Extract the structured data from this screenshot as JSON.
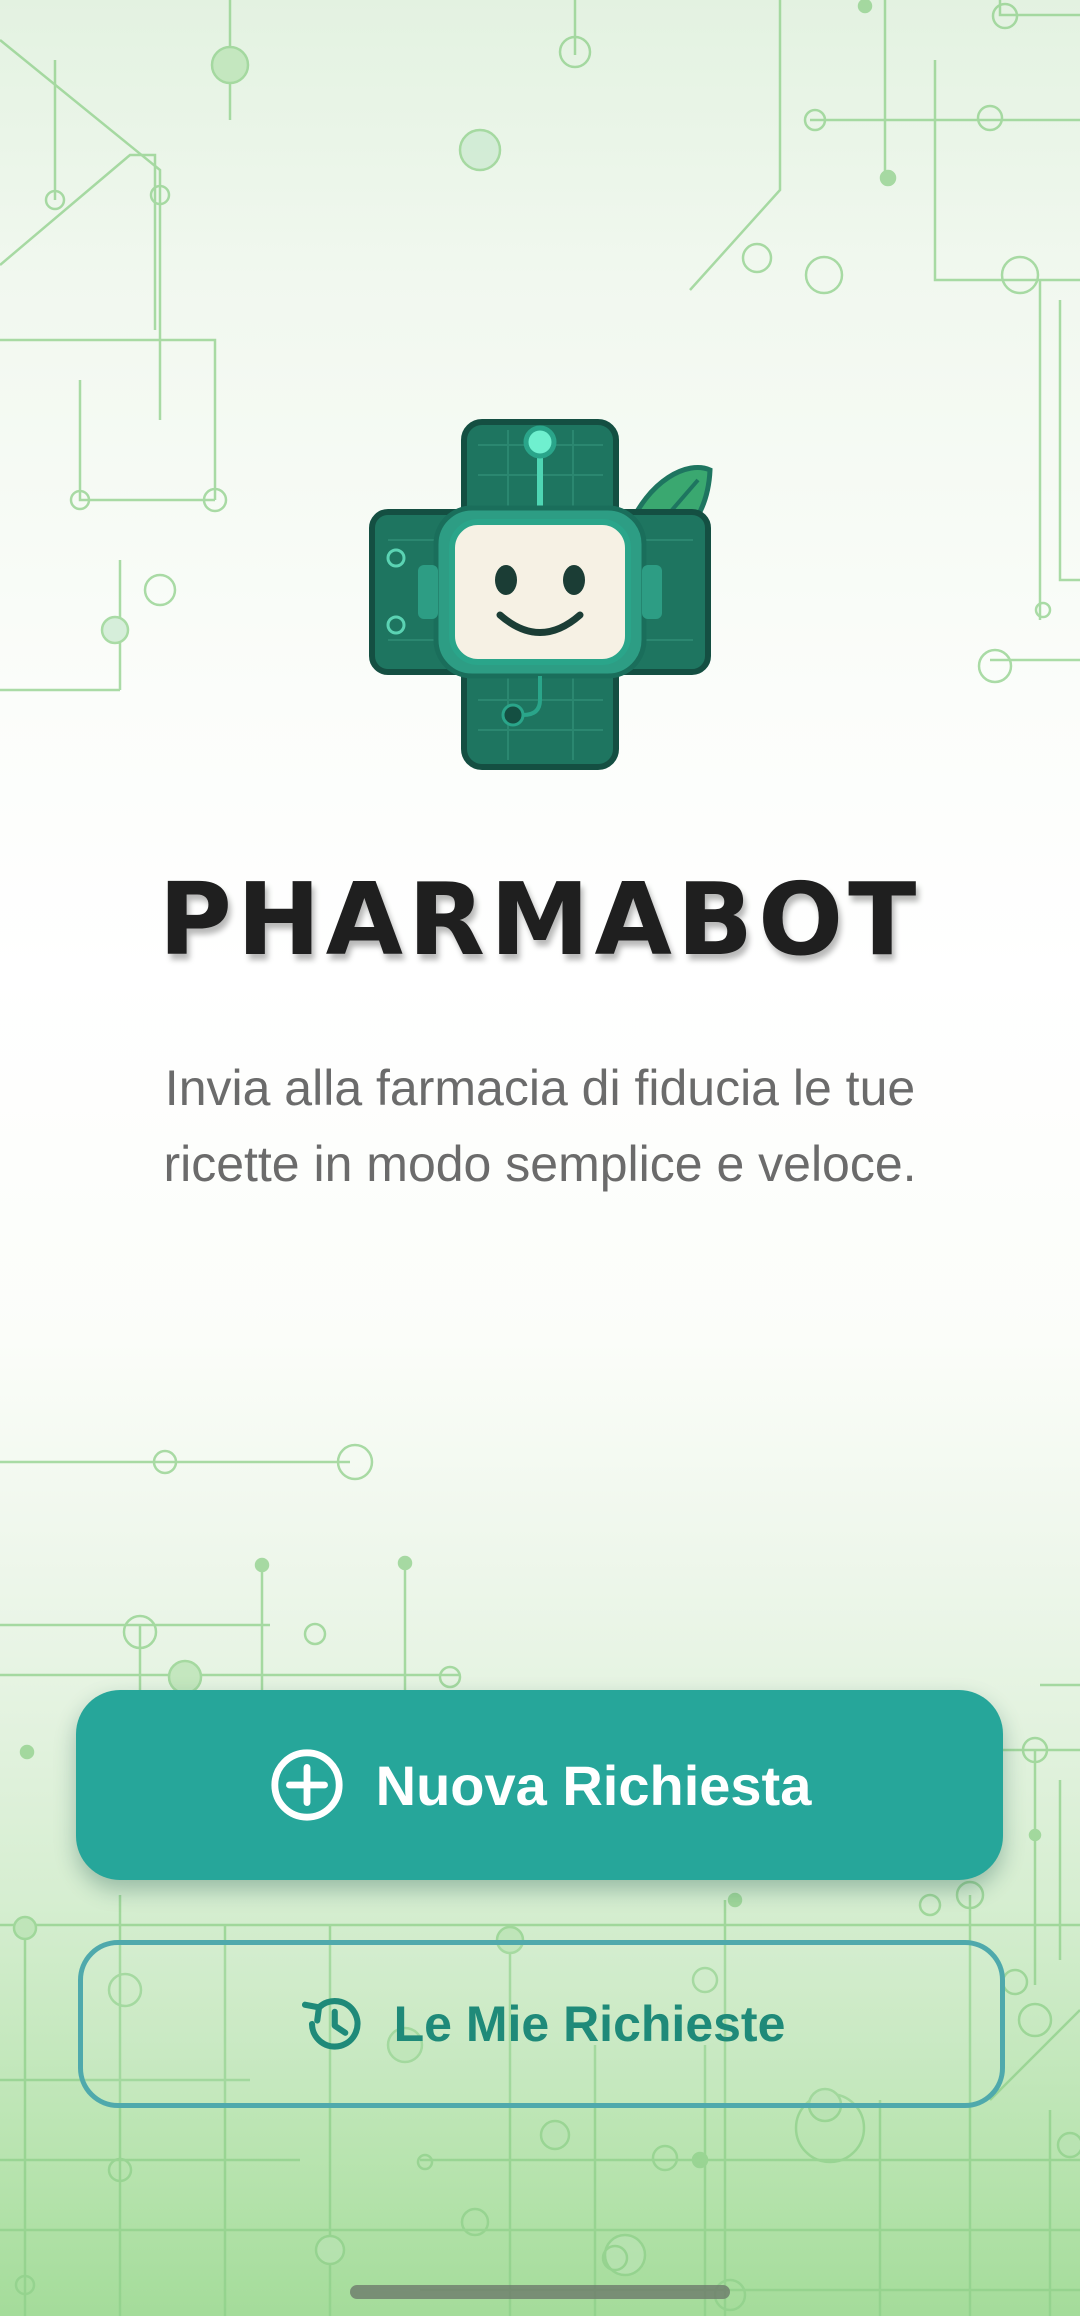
{
  "app": {
    "title": "PHARMABOT",
    "tagline": "Invia alla farmacia di fiducia le tue ricette in modo semplice e veloce."
  },
  "actions": {
    "new_request": {
      "label": "Nuova Richiesta",
      "icon": "plus-circle-icon"
    },
    "my_requests": {
      "label": "Le Mie Richieste",
      "icon": "history-icon"
    }
  },
  "logo": {
    "icon": "robot-medical-cross-logo"
  },
  "colors": {
    "primary": "#26a69a",
    "secondary_border": "#4fa9ac",
    "secondary_text": "#1f8a79",
    "logo_green": "#1e7560",
    "title_text": "#1f1f1f",
    "subtitle_text": "#6b6b6b"
  }
}
